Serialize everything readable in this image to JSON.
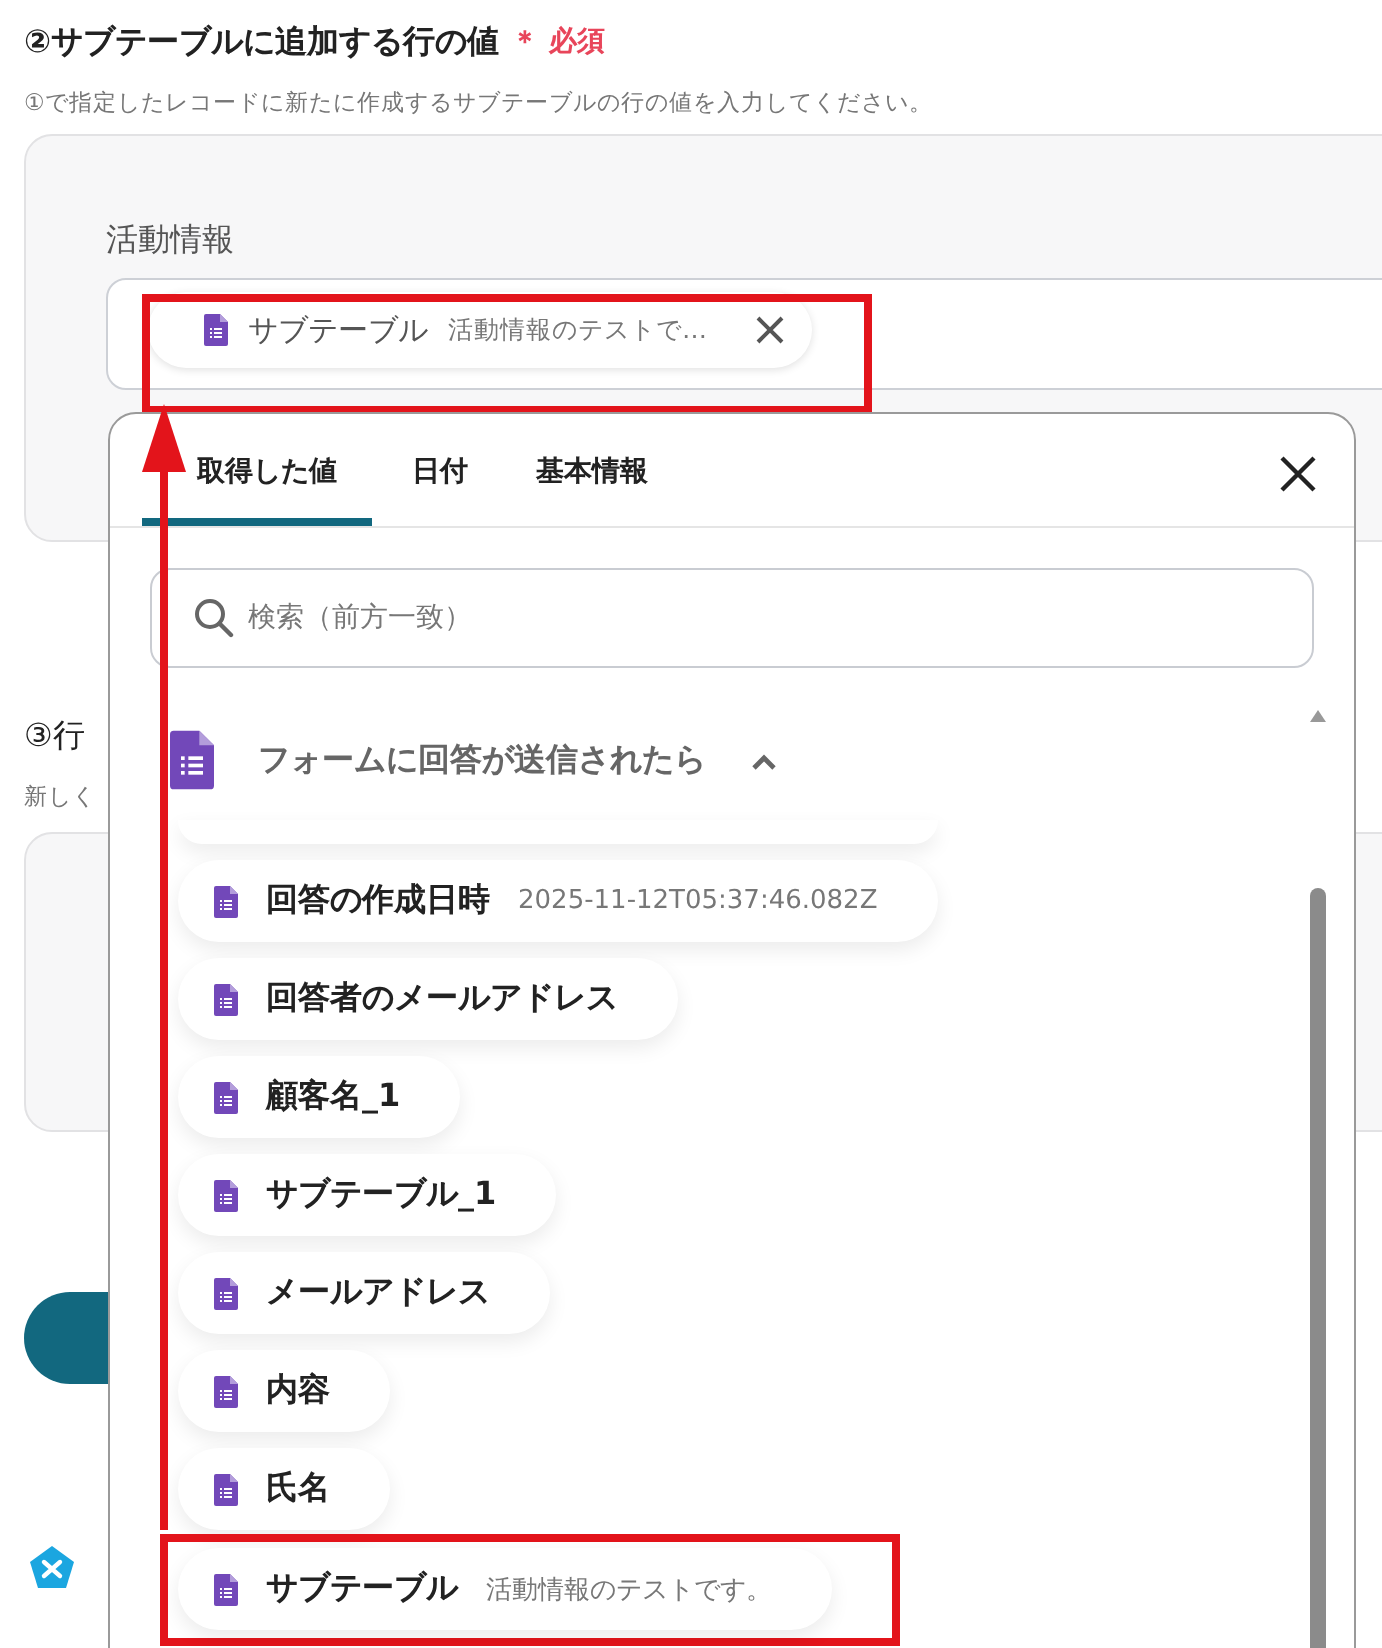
{
  "section2": {
    "title": "②サブテーブルに追加する行の値",
    "required": "＊ 必須",
    "description": "①で指定したレコードに新たに作成するサブテーブルの行の値を入力してください。",
    "field": {
      "label": "活動情報",
      "chip": {
        "name": "サブテーブル",
        "value": "活動情報のテストで…",
        "highlighted": true
      }
    }
  },
  "section3": {
    "title": "③行",
    "description": "新しく"
  },
  "popover": {
    "tabs": [
      {
        "label": "取得した値",
        "selected": true
      },
      {
        "label": "日付",
        "selected": false
      },
      {
        "label": "基本情報",
        "selected": false
      }
    ],
    "search": {
      "placeholder": "検索（前方一致）"
    },
    "group": {
      "title": "フォームに回答が送信されたら",
      "expanded": true
    },
    "items": [
      {
        "name": "回答の作成日時",
        "value": "2025-11-12T05:37:46.082Z",
        "highlighted": false
      },
      {
        "name": "回答者のメールアドレス",
        "highlighted": false
      },
      {
        "name": "顧客名_1",
        "highlighted": false
      },
      {
        "name": "サブテーブル_1",
        "highlighted": false
      },
      {
        "name": "メールアドレス",
        "highlighted": false
      },
      {
        "name": "内容",
        "highlighted": false
      },
      {
        "name": "氏名",
        "highlighted": false
      },
      {
        "name": "サブテーブル",
        "value": "活動情報のテストです。",
        "highlighted": true
      }
    ]
  }
}
